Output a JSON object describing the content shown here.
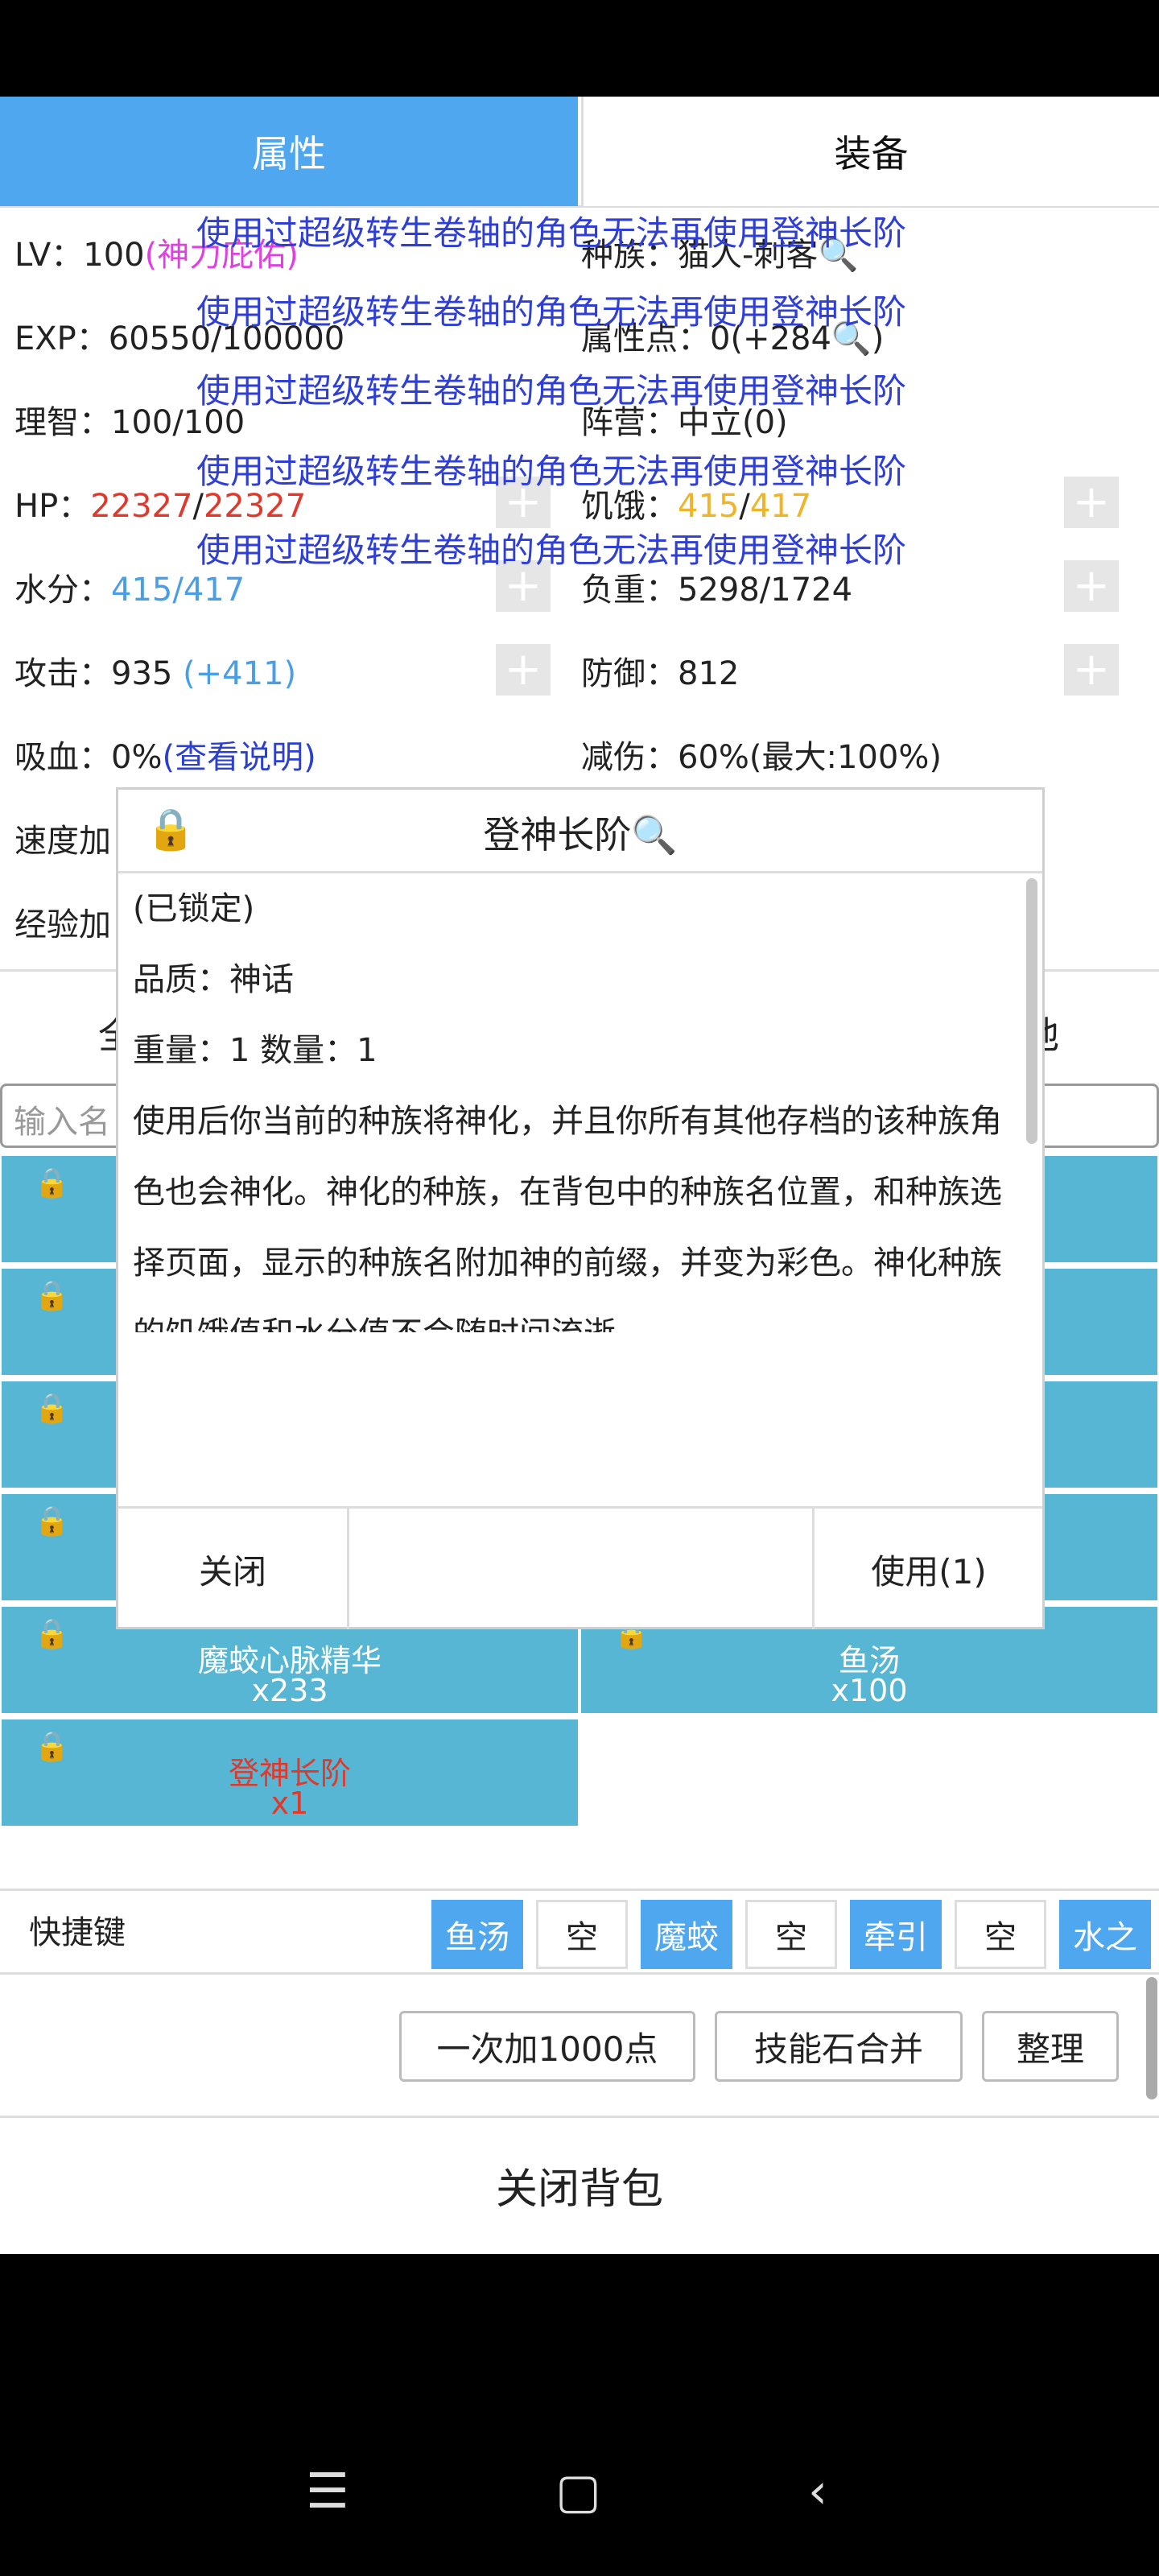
{
  "tabs": {
    "attributes": "属性",
    "equipment": "装备"
  },
  "stats": {
    "lv_label": "LV：",
    "lv_value": "100",
    "lv_badge": "(神力庇佑)",
    "exp_label": "EXP：",
    "exp_value": "60550/100000",
    "sanity_label": "理智：",
    "sanity_value": "100/100",
    "hp_label": "HP：",
    "hp_cur": "22327",
    "hp_sep": "/",
    "hp_max": "22327",
    "water_label": "水分：",
    "water_cur": "415",
    "water_sep": "/",
    "water_max": "417",
    "atk_label": "攻击：",
    "atk_value": "935 ",
    "atk_bonus": "(+411)",
    "lifesteal_label": "吸血：",
    "lifesteal_value": "0%",
    "lifesteal_link": "(查看说明)",
    "speed_label": "速度加",
    "exp_bonus_label": "经验加",
    "race_label": "种族：",
    "race_value": "猫人-刺客",
    "attrpts_label": "属性点：",
    "attrpts_value": "0(+284",
    "attrpts_suffix": ")",
    "faction_label": "阵营：",
    "faction_value": "中立(0)",
    "hunger_label": "饥饿：",
    "hunger_cur": "415",
    "hunger_sep": "/",
    "hunger_max": "417",
    "load_label": "负重：",
    "load_value": "5298/1724",
    "def_label": "防御：",
    "def_value": "812",
    "dmgred_label": "减伤：",
    "dmgred_value": "60%(最大:100%)",
    "plus": "+"
  },
  "warning_text": "使用过超级转生卷轴的角色无法再使用登神长阶",
  "inventory": {
    "tab_left_fragment": "全",
    "tab_right_fragment": "他",
    "search_placeholder": "输入名",
    "slots": [
      {
        "name": "魔蛟心脉精华",
        "qty": "x233"
      },
      {
        "name": "鱼汤",
        "qty": "x100"
      },
      {
        "name": "登神长阶",
        "qty": "x1"
      }
    ]
  },
  "quickbar": {
    "label": "快捷键",
    "slots": [
      "鱼汤",
      "空",
      "魔蛟",
      "空",
      "牵引",
      "空",
      "水之"
    ]
  },
  "actions": {
    "add1000": "一次加1000点",
    "merge": "技能石合并",
    "sort": "整理",
    "close_bag": "关闭背包"
  },
  "modal": {
    "title": "登神长阶",
    "locked": "(已锁定)",
    "quality": "品质：神话",
    "weight_qty": "重量：1  数量：1",
    "description": "使用后你当前的种族将神化，并且你所有其他存档的该种族角色也会神化。神化的种族，在背包中的种族名位置，和种族选择页面，显示的种族名附加神的前缀，并变为彩色。神化种族的饥饿值和水分值不会随时间流逝",
    "close": "关闭",
    "use": "使用(1)"
  },
  "icons": {
    "lock": "lock-icon",
    "search": "magnifier-icon",
    "nav_menu": "menu-icon",
    "nav_home": "home-icon",
    "nav_back": "back-icon"
  }
}
